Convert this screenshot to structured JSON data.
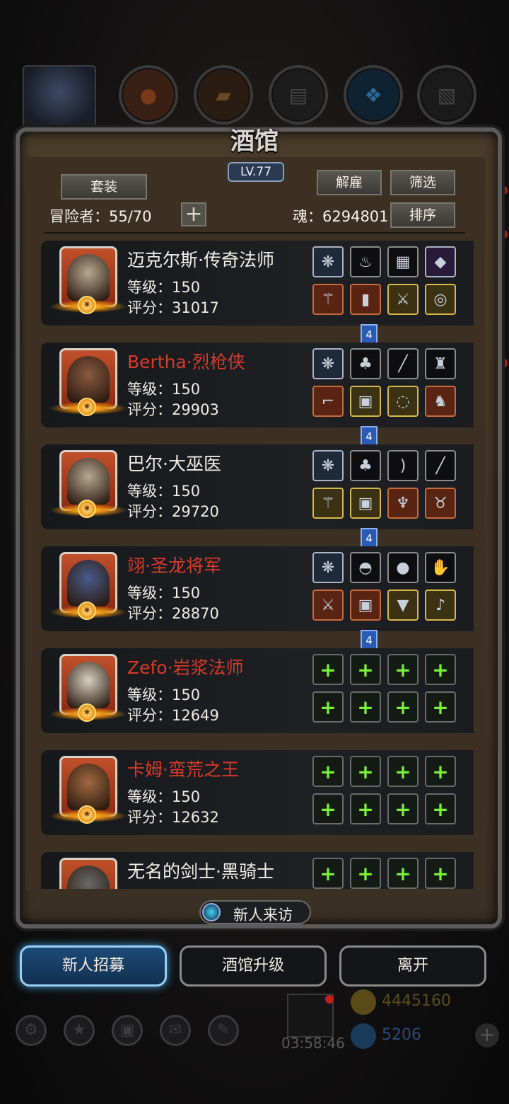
{
  "top_bar": {
    "resource_icons": [
      "meat-icon",
      "wood-icon",
      "stone-icon",
      "crystal-icon",
      "iron-icon"
    ]
  },
  "panel": {
    "title": "酒馆",
    "level": "LV.77",
    "set_button": "套装",
    "dismiss_button": "解雇",
    "filter_button": "筛选",
    "sort_button": "排序",
    "adventurers_text": "冒险者：55/70",
    "soul_text": "魂：6294801",
    "add_button": "+"
  },
  "heroes": [
    {
      "name": "迈克尔斯·传奇法师",
      "name_color": "#f2efe8",
      "level_text": "等级：150",
      "score_text": "评分：31017",
      "link": "4",
      "slots": [
        {
          "type": "blue",
          "icon": "wings-icon",
          "glyph": "❋"
        },
        {
          "type": "black",
          "icon": "potion-icon",
          "glyph": "♨"
        },
        {
          "type": "black",
          "icon": "scroll-icon",
          "glyph": "▦"
        },
        {
          "type": "purple",
          "icon": "gem-icon",
          "glyph": "◆"
        },
        {
          "type": "orange",
          "icon": "staff-icon",
          "glyph": "⚚"
        },
        {
          "type": "orange",
          "icon": "armor-icon",
          "glyph": "▮"
        },
        {
          "type": "gold",
          "icon": "spear-icon",
          "glyph": "⚔"
        },
        {
          "type": "gold",
          "icon": "amulet-icon",
          "glyph": "◎"
        }
      ]
    },
    {
      "name": "Bertha·烈枪侠",
      "name_color": "#d83a2a",
      "level_text": "等级：150",
      "score_text": "评分：29903",
      "link": "4",
      "slots": [
        {
          "type": "blue",
          "icon": "wings-icon",
          "glyph": "❋"
        },
        {
          "type": "black",
          "icon": "potion-icon",
          "glyph": "♣"
        },
        {
          "type": "black",
          "icon": "wand-icon",
          "glyph": "╱"
        },
        {
          "type": "black",
          "icon": "lantern-icon",
          "glyph": "♜"
        },
        {
          "type": "orange",
          "icon": "rifle-icon",
          "glyph": "⌐"
        },
        {
          "type": "gold",
          "icon": "armor-icon",
          "glyph": "▣"
        },
        {
          "type": "gold",
          "icon": "ring-icon",
          "glyph": "◌"
        },
        {
          "type": "orange",
          "icon": "dragon-icon",
          "glyph": "♞"
        }
      ]
    },
    {
      "name": "巴尔·大巫医",
      "name_color": "#f2efe8",
      "level_text": "等级：150",
      "score_text": "评分：29720",
      "link": "4",
      "slots": [
        {
          "type": "blue",
          "icon": "wings-icon",
          "glyph": "❋"
        },
        {
          "type": "black",
          "icon": "potion-icon",
          "glyph": "♣"
        },
        {
          "type": "black",
          "icon": "bow-icon",
          "glyph": ")"
        },
        {
          "type": "black",
          "icon": "wand-icon",
          "glyph": "╱"
        },
        {
          "type": "gold",
          "icon": "staff-icon",
          "glyph": "⚚"
        },
        {
          "type": "gold",
          "icon": "armor-icon",
          "glyph": "▣"
        },
        {
          "type": "orange",
          "icon": "demon-icon",
          "glyph": "♆"
        },
        {
          "type": "orange",
          "icon": "beast-icon",
          "glyph": "♉"
        }
      ]
    },
    {
      "name": "翊·圣龙将军",
      "name_color": "#d83a2a",
      "level_text": "等级：150",
      "score_text": "评分：28870",
      "link": "4",
      "slots": [
        {
          "type": "blue",
          "icon": "wings-icon",
          "glyph": "❋"
        },
        {
          "type": "black",
          "icon": "helmet-icon",
          "glyph": "◓"
        },
        {
          "type": "black",
          "icon": "orb-icon",
          "glyph": "●"
        },
        {
          "type": "black",
          "icon": "gauntlet-icon",
          "glyph": "✋"
        },
        {
          "type": "orange",
          "icon": "sword-icon",
          "glyph": "⚔"
        },
        {
          "type": "orange",
          "icon": "armor-icon",
          "glyph": "▣"
        },
        {
          "type": "gold",
          "icon": "amulet-icon",
          "glyph": "▼"
        },
        {
          "type": "gold",
          "icon": "lute-icon",
          "glyph": "♪"
        }
      ]
    },
    {
      "name": "Zefo·岩浆法师",
      "name_color": "#d83a2a",
      "level_text": "等级：150",
      "score_text": "评分：12649",
      "link": "",
      "slots": [
        {
          "type": "empty",
          "icon": "add-slot-icon",
          "glyph": "+"
        },
        {
          "type": "empty",
          "icon": "add-slot-icon",
          "glyph": "+"
        },
        {
          "type": "empty",
          "icon": "add-slot-icon",
          "glyph": "+"
        },
        {
          "type": "empty",
          "icon": "add-slot-icon",
          "glyph": "+"
        },
        {
          "type": "empty",
          "icon": "add-slot-icon",
          "glyph": "+"
        },
        {
          "type": "empty",
          "icon": "add-slot-icon",
          "glyph": "+"
        },
        {
          "type": "empty",
          "icon": "add-slot-icon",
          "glyph": "+"
        },
        {
          "type": "empty",
          "icon": "add-slot-icon",
          "glyph": "+"
        }
      ]
    },
    {
      "name": "卡姆·蛮荒之王",
      "name_color": "#d83a2a",
      "level_text": "等级：150",
      "score_text": "评分：12632",
      "link": "",
      "slots": [
        {
          "type": "empty",
          "icon": "add-slot-icon",
          "glyph": "+"
        },
        {
          "type": "empty",
          "icon": "add-slot-icon",
          "glyph": "+"
        },
        {
          "type": "empty",
          "icon": "add-slot-icon",
          "glyph": "+"
        },
        {
          "type": "empty",
          "icon": "add-slot-icon",
          "glyph": "+"
        },
        {
          "type": "empty",
          "icon": "add-slot-icon",
          "glyph": "+"
        },
        {
          "type": "empty",
          "icon": "add-slot-icon",
          "glyph": "+"
        },
        {
          "type": "empty",
          "icon": "add-slot-icon",
          "glyph": "+"
        },
        {
          "type": "empty",
          "icon": "add-slot-icon",
          "glyph": "+"
        }
      ]
    },
    {
      "name": "无名的剑士·黑骑士",
      "name_color": "#f2efe8",
      "level_text": "",
      "score_text": "",
      "link": "",
      "slots": [
        {
          "type": "empty",
          "icon": "add-slot-icon",
          "glyph": "+"
        },
        {
          "type": "empty",
          "icon": "add-slot-icon",
          "glyph": "+"
        },
        {
          "type": "empty",
          "icon": "add-slot-icon",
          "glyph": "+"
        },
        {
          "type": "empty",
          "icon": "add-slot-icon",
          "glyph": "+"
        }
      ]
    }
  ],
  "newcomer_label": "新人来访",
  "bottom_buttons": {
    "recruit": "新人招募",
    "upgrade": "酒馆升级",
    "leave": "离开"
  },
  "currency": {
    "gold": "4445160",
    "gems": "5206"
  },
  "timer": "03:58:46"
}
